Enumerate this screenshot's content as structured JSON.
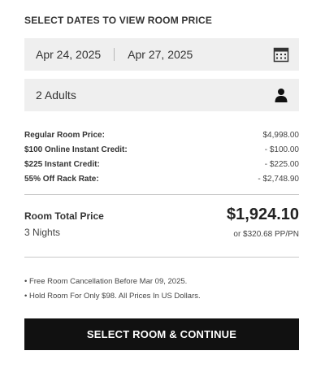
{
  "header": {
    "title": "SELECT DATES TO VIEW ROOM PRICE"
  },
  "dates": {
    "check_in": "Apr 24, 2025",
    "check_out": "Apr 27, 2025",
    "icon": "calendar-icon"
  },
  "guests": {
    "value": "2 Adults",
    "icon": "person-icon"
  },
  "price_lines": [
    {
      "label": "Regular Room Price:",
      "value": "$4,998.00"
    },
    {
      "label": "$100 Online Instant Credit:",
      "value": "- $100.00"
    },
    {
      "label": "$225 Instant Credit:",
      "value": "- $225.00"
    },
    {
      "label": "55% Off Rack Rate:",
      "value": "- $2,748.90"
    }
  ],
  "total": {
    "label": "Room Total Price",
    "nights": "3 Nights",
    "price": "$1,924.10",
    "per_person": "or $320.68 PP/PN"
  },
  "notes": [
    "• Free Room Cancellation Before Mar 09, 2025.",
    "• Hold Room For Only $98. All Prices In US Dollars."
  ],
  "cta": {
    "label": "SELECT ROOM & CONTINUE"
  },
  "colors": {
    "field_bg": "#efefef",
    "button_bg": "#111111",
    "button_text": "#ffffff"
  }
}
